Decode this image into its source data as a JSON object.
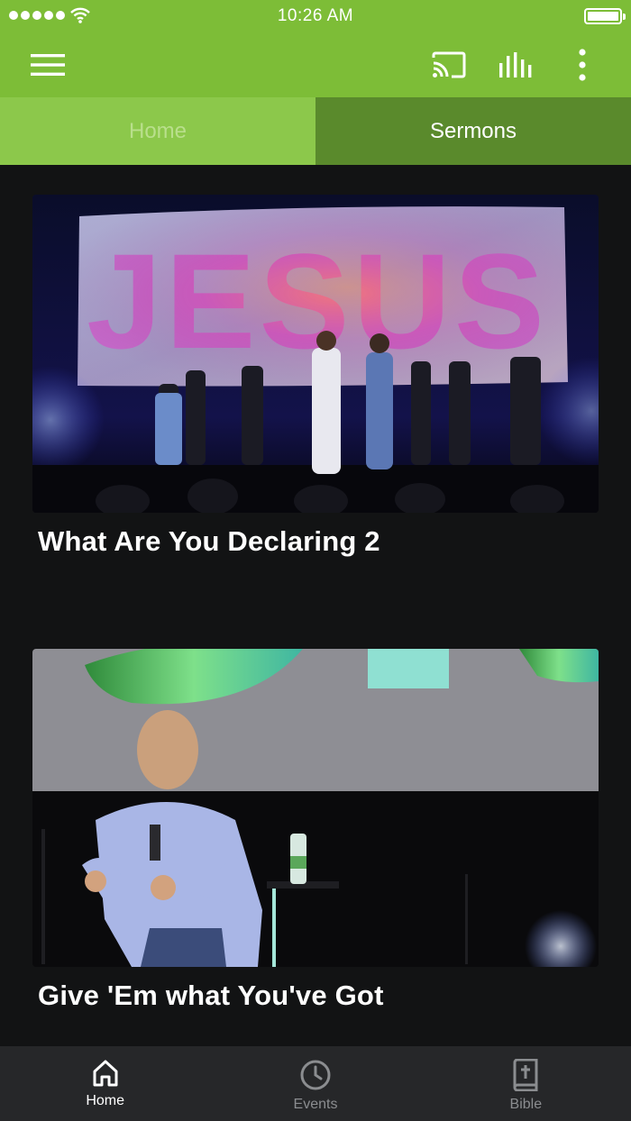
{
  "status_bar": {
    "time": "10:26 AM",
    "signal_icon": "signal-dots-icon",
    "wifi_icon": "wifi-icon",
    "battery_icon": "battery-icon"
  },
  "app_bar": {
    "menu_icon": "hamburger-menu-icon",
    "cast_icon": "cast-icon",
    "audio_icon": "audio-bars-icon",
    "more_icon": "more-vertical-icon",
    "color": "#7dbd37"
  },
  "tabs": [
    {
      "label": "Home",
      "selected": false
    },
    {
      "label": "Sermons",
      "selected": true
    }
  ],
  "sermons": [
    {
      "title": "What Are You Declaring 2",
      "thumbnail": "stage-worship-jesus-backdrop"
    },
    {
      "title": "Give 'Em what You've Got",
      "thumbnail": "speaker-with-microphone"
    }
  ],
  "bottom_nav": [
    {
      "label": "Home",
      "icon": "home-icon",
      "active": true
    },
    {
      "label": "Events",
      "icon": "clock-icon",
      "active": false
    },
    {
      "label": "Bible",
      "icon": "bible-icon",
      "active": false
    }
  ],
  "colors": {
    "brand_green": "#7dbd37",
    "tab_selected": "#5a8a2c",
    "background": "#121314",
    "bottom_nav": "#262729"
  }
}
